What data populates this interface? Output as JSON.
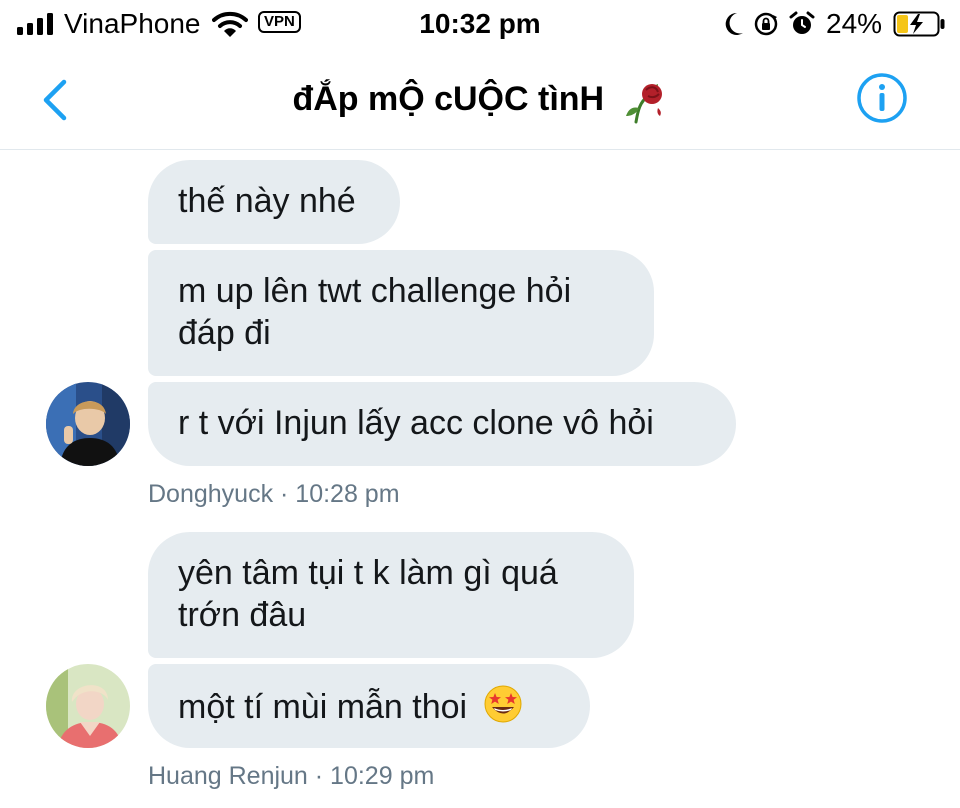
{
  "status_bar": {
    "carrier": "VinaPhone",
    "vpn_label": "VPN",
    "time": "10:32 pm",
    "battery_percent": "24%",
    "icons": [
      "signal-icon",
      "wifi-icon",
      "moon-icon",
      "rotation-lock-icon",
      "alarm-icon",
      "battery-charging-icon"
    ]
  },
  "header": {
    "title": "đẮp mỘ cUỘC tìnH",
    "title_emoji": "wilted-rose-icon",
    "back_icon": "chevron-left-icon",
    "info_icon": "info-icon"
  },
  "messages": [
    {
      "sender": "Donghyuck",
      "text": "thế này nhé"
    },
    {
      "sender": "Donghyuck",
      "text_lines": [
        "m up lên twt challenge hỏi",
        "đáp đi"
      ]
    },
    {
      "sender": "Donghyuck",
      "text": "r t với Injun lấy acc clone vô hỏi"
    },
    {
      "sender": "Huang Renjun",
      "text_lines": [
        "yên tâm tụi t k làm gì quá",
        "trớn đâu"
      ]
    },
    {
      "sender": "Huang Renjun",
      "text": "một tí mùi mẫn thoi",
      "emoji": "star-struck-emoji"
    }
  ],
  "groups": [
    {
      "meta": "Donghyuck · 10:28 pm"
    },
    {
      "meta": "Huang Renjun · 10:29 pm"
    }
  ],
  "colors": {
    "accent": "#1da1f2",
    "bubble": "#e6ecf0",
    "meta_text": "#657786"
  }
}
